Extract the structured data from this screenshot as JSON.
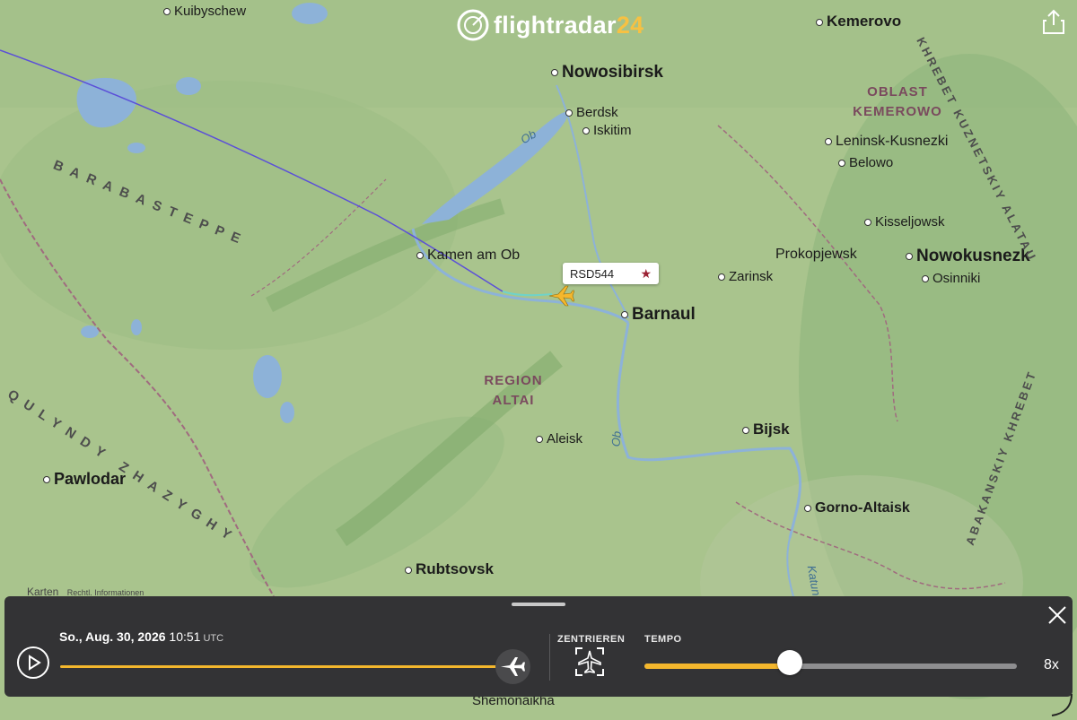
{
  "brand": {
    "name_part1": "flightradar",
    "name_part2": "24"
  },
  "map": {
    "cities": [
      {
        "name": "Kuibyschew",
        "cls": "small"
      },
      {
        "name": "Kemerovo",
        "cls": "mid"
      },
      {
        "name": "Nowosibirsk",
        "cls": "big"
      },
      {
        "name": "Berdsk",
        "cls": "small"
      },
      {
        "name": "Iskitim",
        "cls": "small"
      },
      {
        "name": "Leninsk-Kusnezki",
        "cls": "small"
      },
      {
        "name": "Belowo",
        "cls": "small"
      },
      {
        "name": "Kisseljowsk",
        "cls": "small"
      },
      {
        "name": "Prokopjewsk",
        "cls": "small"
      },
      {
        "name": "Nowokusnezk",
        "cls": "big"
      },
      {
        "name": "Osinniki",
        "cls": "small"
      },
      {
        "name": "Kamen am Ob",
        "cls": "small"
      },
      {
        "name": "Zarinsk",
        "cls": "small"
      },
      {
        "name": "Barnaul",
        "cls": "big"
      },
      {
        "name": "Aleisk",
        "cls": "small"
      },
      {
        "name": "Bijsk",
        "cls": "mid"
      },
      {
        "name": "Pawlodar",
        "cls": "mid"
      },
      {
        "name": "Gorno-Altaisk",
        "cls": "mid"
      },
      {
        "name": "Rubtsovsk",
        "cls": "mid"
      },
      {
        "name": "Shemonaikha",
        "cls": "small"
      }
    ],
    "regions": [
      {
        "line1": "OBLAST",
        "line2": "KEMEROWO"
      },
      {
        "line1": "REGION",
        "line2": "ALTAI"
      }
    ],
    "steppes": [
      "BARABASTEPPE",
      "QULYNDY ZHAZYGHY",
      "KHREBET KUZNETSKIY ALATAU",
      "ABAKANSKIY KHREBET"
    ],
    "rivers": [
      "Ob",
      "Ob",
      "Katun"
    ],
    "attribution": {
      "maps": "Karten",
      "legal": "Rechtl. Informationen"
    },
    "colors": {
      "land": "#a9c48d",
      "water": "#8db2d8",
      "route": "#5b4fd8",
      "route_recent": "#6fd3c9",
      "plane": "#f4b72d"
    }
  },
  "flight": {
    "callsign": "RSD544",
    "favorite_icon": "★"
  },
  "playback": {
    "date_label": "So., Aug. 30, 2026",
    "time": "10:51",
    "timezone": "UTC",
    "progress": 1.0,
    "center_label": "ZENTRIEREN",
    "tempo_label": "TEMPO",
    "tempo_fraction": 0.39,
    "speed_label": "8x",
    "accent": "#f4b72d"
  }
}
